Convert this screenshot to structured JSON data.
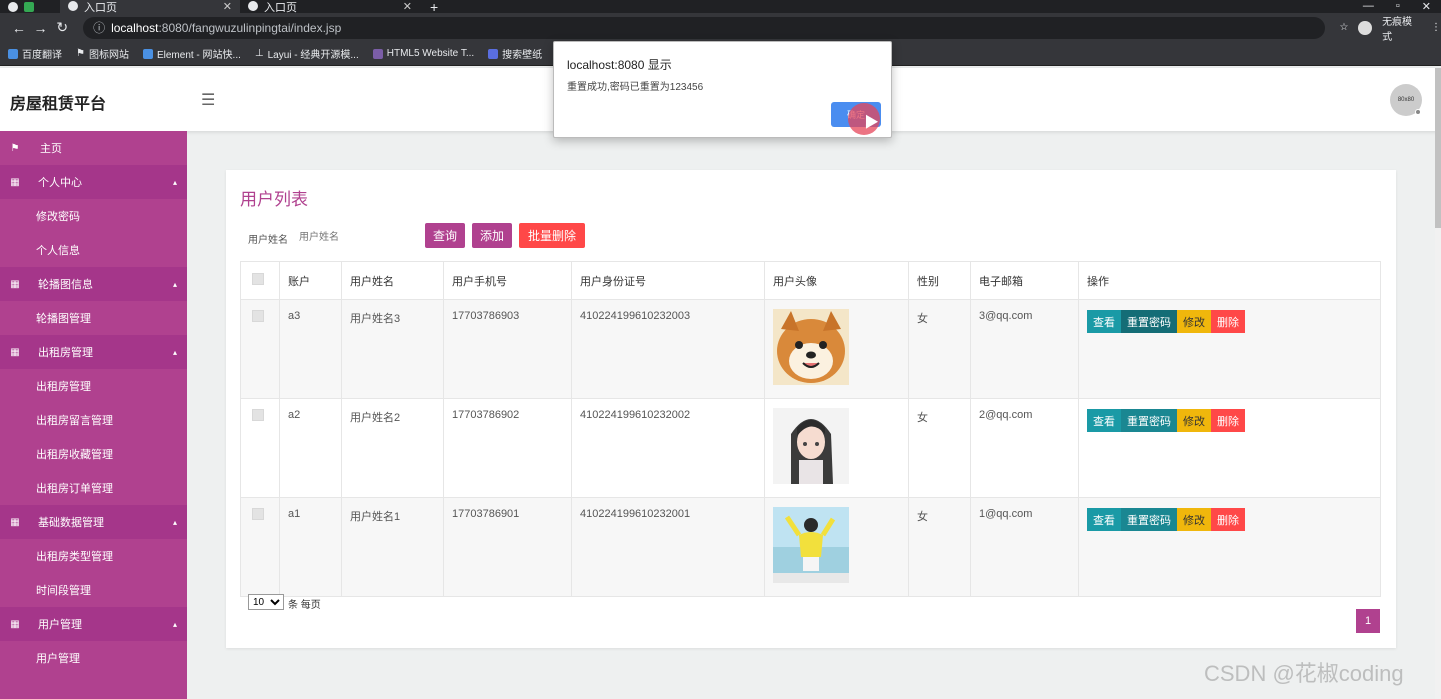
{
  "browser": {
    "tabs": [
      {
        "label": "",
        "active": false
      },
      {
        "label": "入口页",
        "active": true
      },
      {
        "label": "入口页",
        "active": false
      }
    ],
    "url_host": "localhost",
    "url_rest": ":8080/fangwuzulinpingtai/index.jsp",
    "incognito_label": "无痕模式",
    "bookmarks": [
      "百度翻译",
      "图标网站",
      "Element - 网站快...",
      "Layui - 经典开源模...",
      "HTML5 Website T...",
      "搜索壁纸"
    ]
  },
  "dialog": {
    "title": "localhost:8080 显示",
    "message": "重置成功,密码已重置为123456",
    "ok_label": "确定"
  },
  "header": {
    "brand": "房屋租赁平台",
    "avatar_text": "80x80"
  },
  "sidebar": {
    "items": [
      {
        "label": "主页",
        "kind": "top",
        "icon": "flag-icon"
      },
      {
        "label": "个人中心",
        "kind": "group",
        "icon": "grid-icon"
      },
      {
        "label": "修改密码",
        "kind": "sub"
      },
      {
        "label": "个人信息",
        "kind": "sub"
      },
      {
        "label": "轮播图信息",
        "kind": "group",
        "icon": "grid-icon"
      },
      {
        "label": "轮播图管理",
        "kind": "sub"
      },
      {
        "label": "出租房管理",
        "kind": "group",
        "icon": "grid-icon"
      },
      {
        "label": "出租房管理",
        "kind": "sub"
      },
      {
        "label": "出租房留言管理",
        "kind": "sub"
      },
      {
        "label": "出租房收藏管理",
        "kind": "sub"
      },
      {
        "label": "出租房订单管理",
        "kind": "sub"
      },
      {
        "label": "基础数据管理",
        "kind": "group",
        "icon": "grid-icon"
      },
      {
        "label": "出租房类型管理",
        "kind": "sub"
      },
      {
        "label": "时间段管理",
        "kind": "sub"
      },
      {
        "label": "用户管理",
        "kind": "group",
        "icon": "grid-icon"
      },
      {
        "label": "用户管理",
        "kind": "sub"
      }
    ]
  },
  "main": {
    "title": "用户列表",
    "search": {
      "label": "用户姓名",
      "placeholder": "用户姓名"
    },
    "buttons": {
      "query": "查询",
      "add": "添加",
      "batch_delete": "批量删除"
    },
    "columns": [
      "账户",
      "用户姓名",
      "用户手机号",
      "用户身份证号",
      "用户头像",
      "性别",
      "电子邮箱",
      "操作"
    ],
    "rows": [
      {
        "account": "a3",
        "name": "用户姓名3",
        "phone": "17703786903",
        "id_card": "410224199610232003",
        "avatar": "shiba-dog-avatar",
        "gender": "女",
        "email": "3@qq.com"
      },
      {
        "account": "a2",
        "name": "用户姓名2",
        "phone": "17703786902",
        "id_card": "410224199610232002",
        "avatar": "anime-girl-avatar",
        "gender": "女",
        "email": "2@qq.com"
      },
      {
        "account": "a1",
        "name": "用户姓名1",
        "phone": "17703786901",
        "id_card": "410224199610232001",
        "avatar": "yellow-girl-photo",
        "gender": "女",
        "email": "1@qq.com"
      }
    ],
    "row_actions": {
      "view": "查看",
      "reset": "重置密码",
      "edit": "修改",
      "delete": "删除"
    },
    "pagination": {
      "page_size": "10",
      "page_size_suffix": "条 每页",
      "current_page": "1"
    }
  },
  "watermark": "CSDN @花椒coding"
}
